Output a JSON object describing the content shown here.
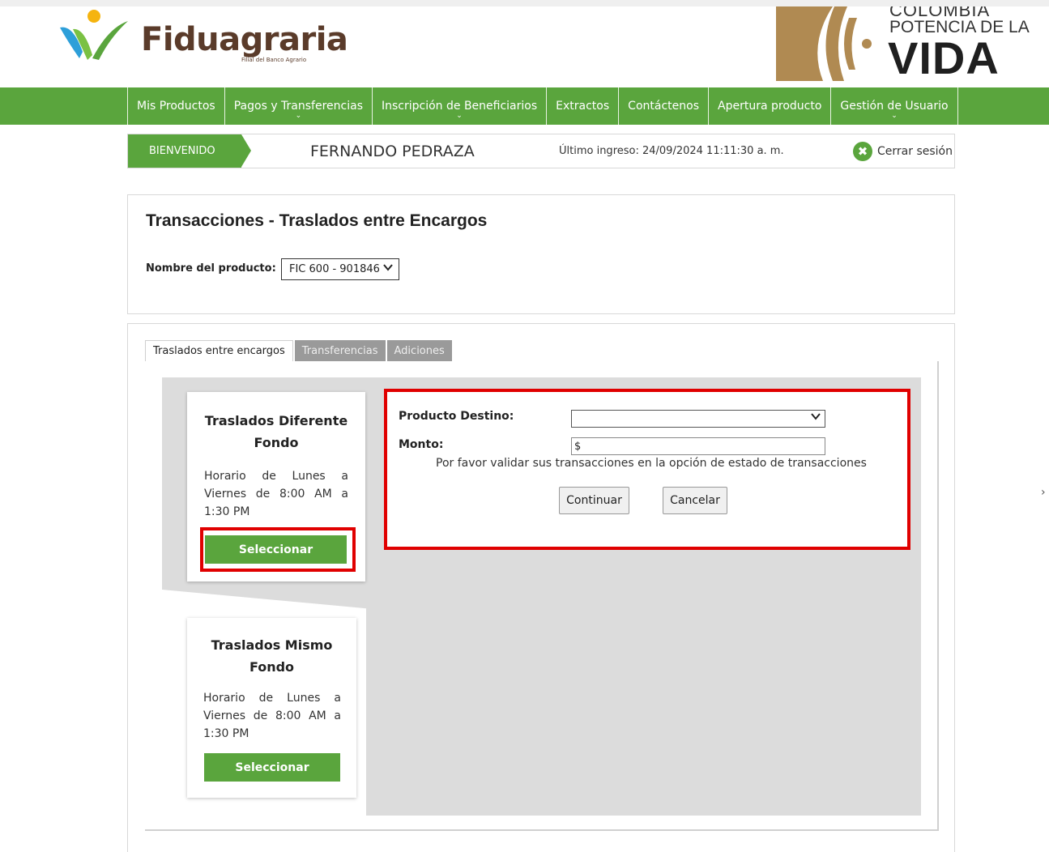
{
  "brand": {
    "name": "Fiduagraria",
    "subtitle": "Filial del Banco Agrario",
    "gov_line1": "COLOMBIA",
    "gov_line2": "POTENCIA DE LA",
    "gov_line3": "VIDA"
  },
  "nav": {
    "items": [
      {
        "label": "Mis Productos",
        "dropdown": false
      },
      {
        "label": "Pagos y Transferencias",
        "dropdown": true
      },
      {
        "label": "Inscripción de Beneficiarios",
        "dropdown": true
      },
      {
        "label": "Extractos",
        "dropdown": false
      },
      {
        "label": "Contáctenos",
        "dropdown": false
      },
      {
        "label": "Apertura producto",
        "dropdown": false
      },
      {
        "label": "Gestión de Usuario",
        "dropdown": true
      }
    ],
    "caret": "⌄"
  },
  "welcome": {
    "badge": "BIENVENIDO",
    "user": "FERNANDO PEDRAZA",
    "last_login": "Último ingreso: 24/09/2024 11:11:30 a. m.",
    "logout": "Cerrar sesión",
    "logout_icon": "✖"
  },
  "page": {
    "title": "Transacciones - Traslados entre Encargos",
    "product_label": "Nombre del producto:",
    "product_value": "FIC 600 - 901846"
  },
  "tabs": [
    {
      "label": "Traslados entre encargos",
      "active": true
    },
    {
      "label": "Transferencias",
      "active": false
    },
    {
      "label": "Adiciones",
      "active": false
    }
  ],
  "cards": [
    {
      "title": "Traslados Diferente Fondo",
      "schedule": "Horario de Lunes a Viernes de 8:00 AM a 1:30 PM",
      "button": "Seleccionar"
    },
    {
      "title": "Traslados Mismo Fondo",
      "schedule": "Horario de Lunes a Viernes de 8:00 AM a 1:30 PM",
      "button": "Seleccionar"
    }
  ],
  "form": {
    "destino_label": "Producto Destino:",
    "destino_value": "",
    "monto_label": "Monto:",
    "monto_value": "$",
    "note": "Por favor validar sus transacciones en la opción de estado de transacciones",
    "continue": "Continuar",
    "cancel": "Cancelar"
  },
  "colors": {
    "brand_green": "#5aa53d",
    "highlight_red": "#e00000"
  }
}
